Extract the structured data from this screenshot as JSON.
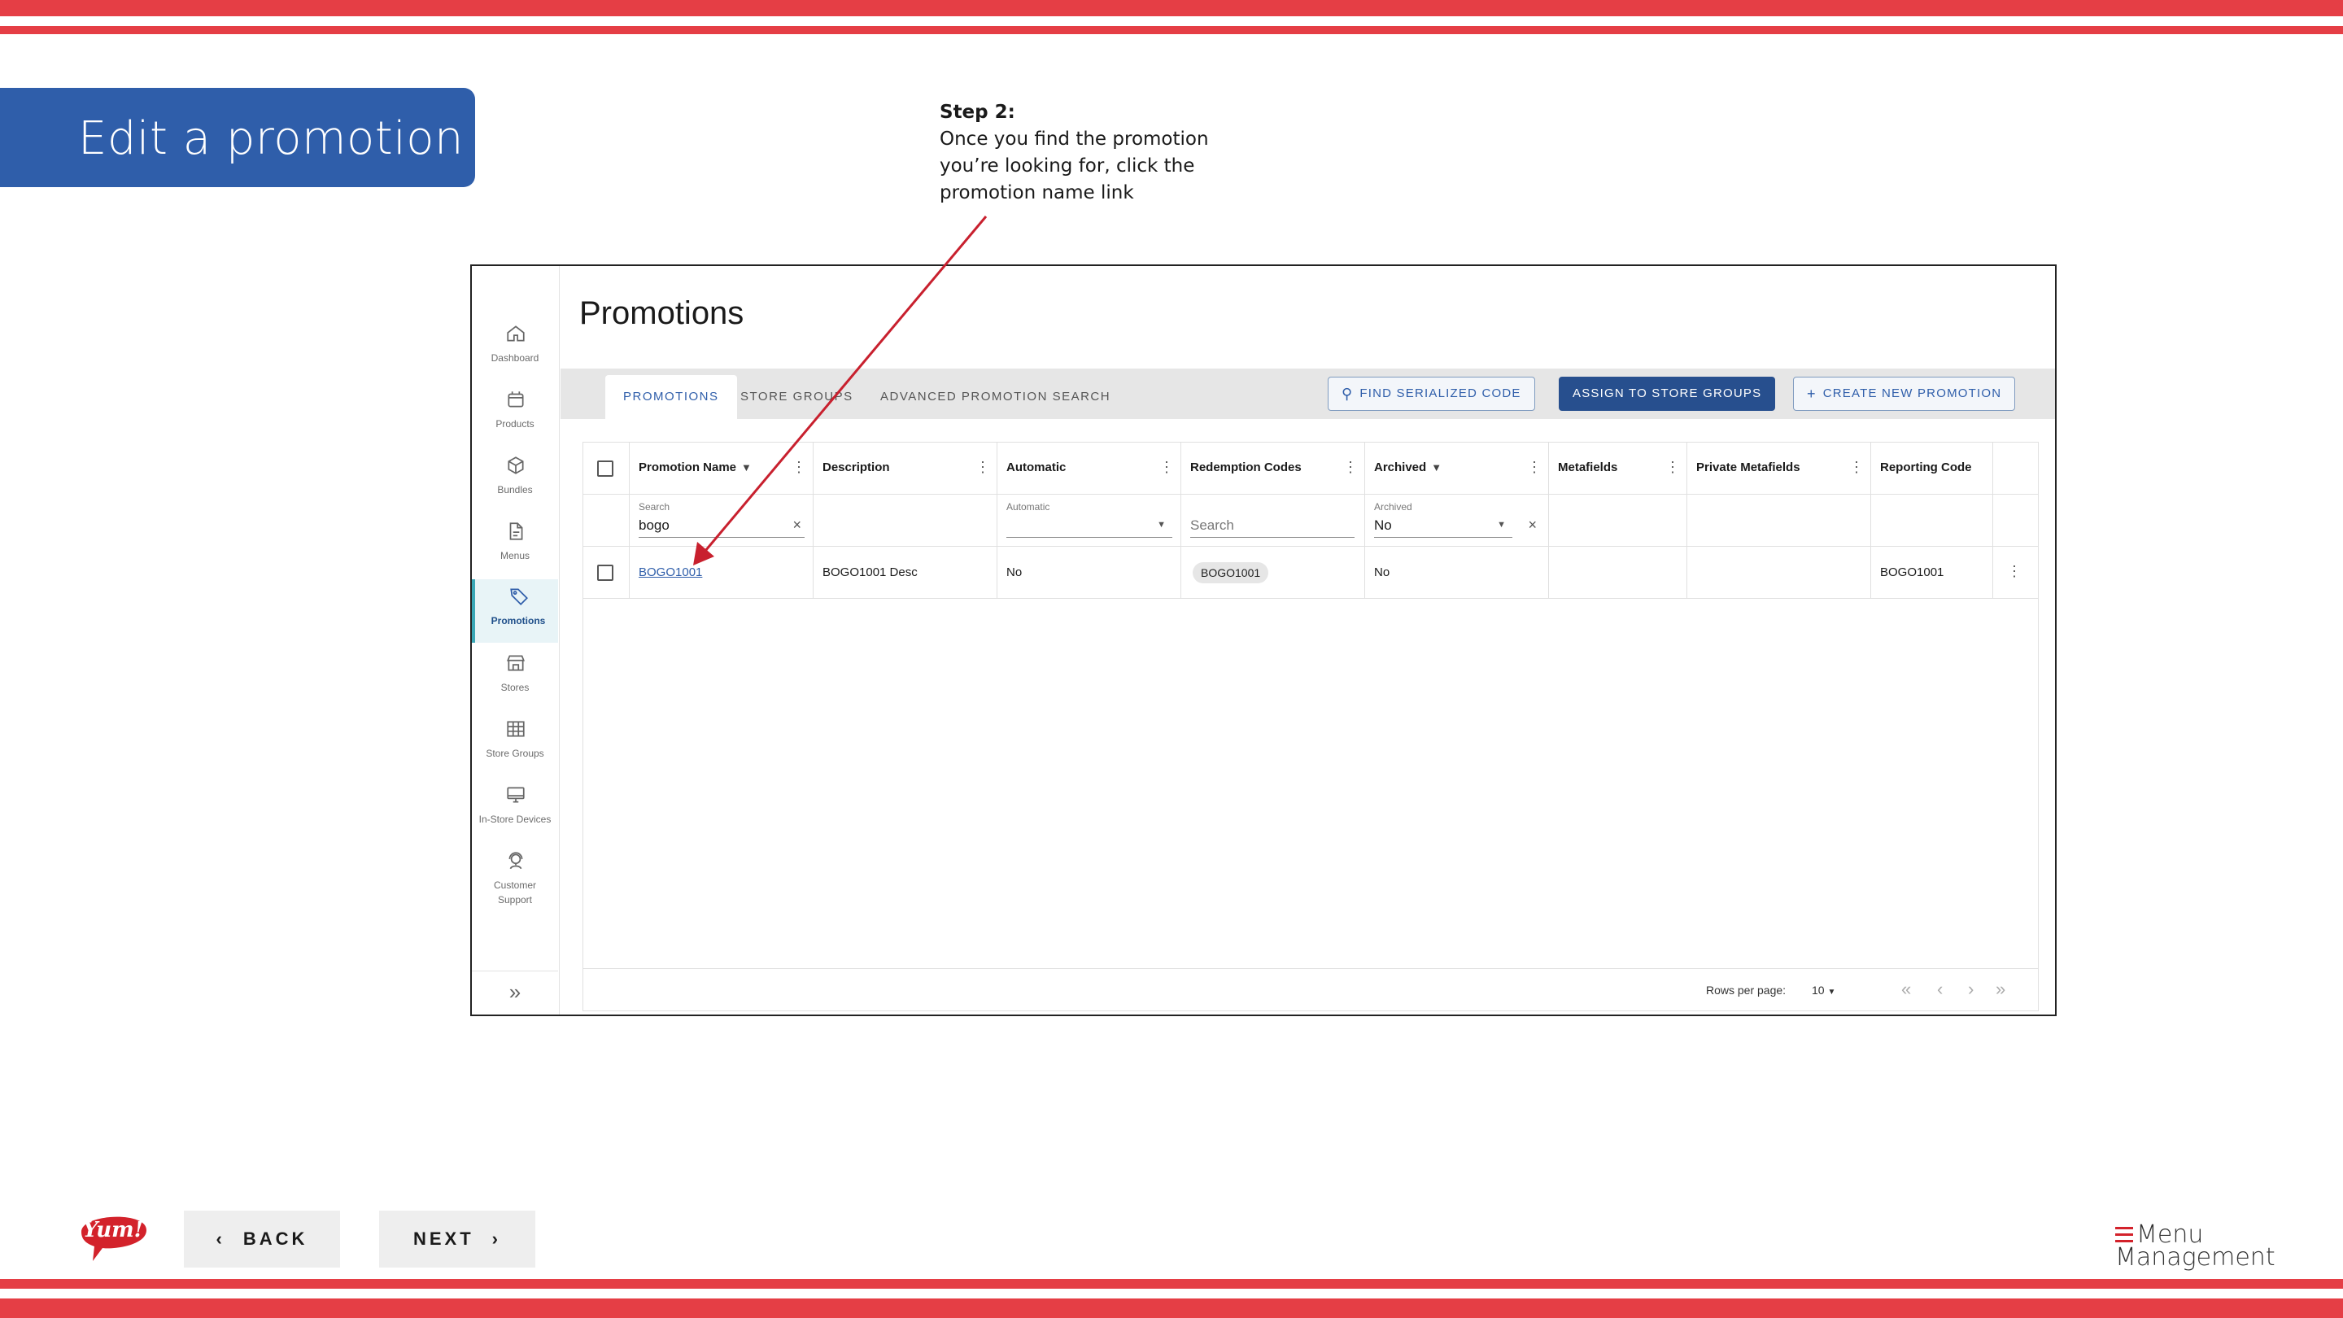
{
  "slide": {
    "title": "Edit a promotion",
    "callout_step": "Step 2:",
    "callout_text": "Once you find the promotion you’re looking for, click the promotion name link",
    "back_label": "BACK",
    "next_label": "NEXT",
    "yum_logo_text": "Yum!",
    "brand_line1": "Menu",
    "brand_line2": "Management",
    "accent_color": "#e53e45",
    "title_bg_color": "#2f5eaa"
  },
  "sidebar": {
    "items": [
      {
        "label": "Dashboard",
        "icon": "home-icon"
      },
      {
        "label": "Products",
        "icon": "box-icon"
      },
      {
        "label": "Bundles",
        "icon": "cube-icon"
      },
      {
        "label": "Menus",
        "icon": "document-icon"
      },
      {
        "label": "Promotions",
        "icon": "tag-icon"
      },
      {
        "label": "Stores",
        "icon": "store-icon"
      },
      {
        "label": "Store Groups",
        "icon": "grid-icon"
      },
      {
        "label": "In-Store Devices",
        "icon": "monitor-icon"
      },
      {
        "label": "Customer Support",
        "icon": "headset-icon"
      }
    ],
    "active": "Promotions"
  },
  "page": {
    "title": "Promotions",
    "tabs": [
      "PROMOTIONS",
      "STORE GROUPS",
      "ADVANCED PROMOTION SEARCH"
    ],
    "active_tab": "PROMOTIONS",
    "buttons": {
      "find_serialized": "FIND SERIALIZED CODE",
      "assign": "ASSIGN TO STORE GROUPS",
      "create": "CREATE NEW PROMOTION"
    }
  },
  "table": {
    "columns": [
      "Promotion Name",
      "Description",
      "Automatic",
      "Redemption Codes",
      "Archived",
      "Metafields",
      "Private Metafields",
      "Reporting Code"
    ],
    "filters": {
      "name_label": "Search",
      "name_value": "bogo",
      "automatic_label": "Automatic",
      "redemption_placeholder": "Search",
      "archived_label": "Archived",
      "archived_value": "No"
    },
    "rows": [
      {
        "name": "BOGO1001",
        "description": "BOGO1001 Desc",
        "automatic": "No",
        "redemption_code": "BOGO1001",
        "archived": "No",
        "metafields": "",
        "private_metafields": "",
        "reporting_code": "BOGO1001"
      }
    ],
    "pager": {
      "rows_per_page_label": "Rows per page:",
      "rows_per_page_value": "10"
    }
  }
}
